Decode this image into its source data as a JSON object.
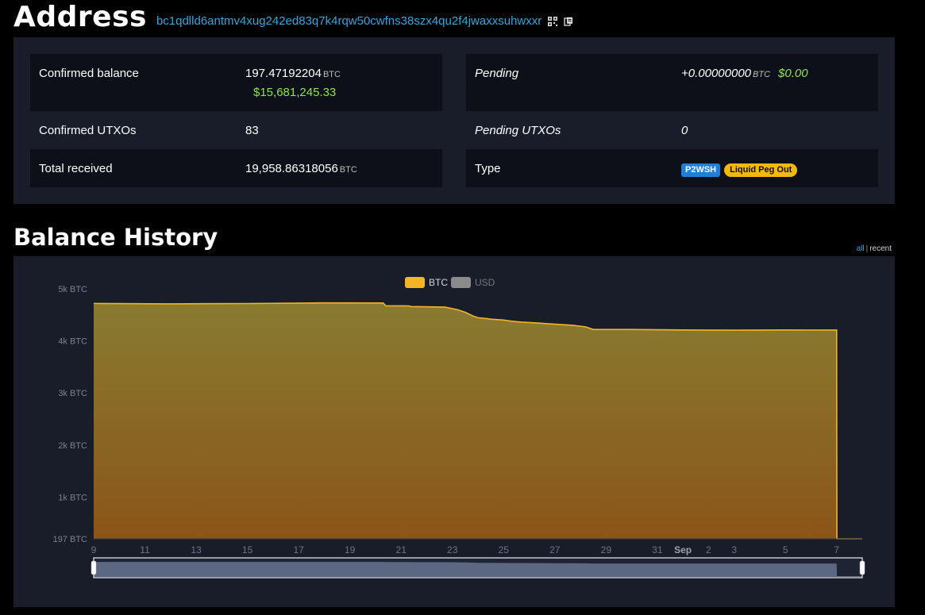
{
  "header": {
    "title": "Address",
    "address": "bc1qdlld6antmv4xug242ed83q7k4rqw50cwfns38szx4qu2f4jwaxxsuhwxxr",
    "qr_icon": "qr-code-icon",
    "copy_icon": "copy-icon"
  },
  "summary": {
    "confirmed_balance": {
      "label": "Confirmed balance",
      "value": "197.47192204",
      "unit": "BTC",
      "usd": "$15,681,245.33"
    },
    "confirmed_utxos": {
      "label": "Confirmed UTXOs",
      "value": "83"
    },
    "total_received": {
      "label": "Total received",
      "value": "19,958.86318056",
      "unit": "BTC"
    },
    "pending": {
      "label": "Pending",
      "value": "+0.00000000",
      "unit": "BTC",
      "usd": "$0.00"
    },
    "pending_utxos": {
      "label": "Pending UTXOs",
      "value": "0"
    },
    "type": {
      "label": "Type",
      "badges": [
        "P2WSH",
        "Liquid Peg Out"
      ]
    }
  },
  "balance_history": {
    "title": "Balance History",
    "range_links": [
      "all",
      "recent"
    ],
    "active_range": "all"
  },
  "colors": {
    "accent": "#2fa8df",
    "usd_green": "#8de34a",
    "btc_series": "#f5b426",
    "usd_series": "#8a8a8a",
    "panel": "#191d2a",
    "badge_blue": "#1e7fd8",
    "badge_yellow": "#f2b90a"
  },
  "chart_data": {
    "type": "area",
    "legend": [
      {
        "name": "BTC",
        "active": true
      },
      {
        "name": "USD",
        "active": false
      }
    ],
    "y_ticks": [
      "197 BTC",
      "1k BTC",
      "2k BTC",
      "3k BTC",
      "4k BTC",
      "5k BTC"
    ],
    "y_tick_values": [
      197,
      1000,
      2000,
      3000,
      4000,
      5000
    ],
    "ylim": [
      197,
      5000
    ],
    "x_ticks": [
      "9",
      "11",
      "13",
      "15",
      "17",
      "19",
      "21",
      "23",
      "25",
      "27",
      "29",
      "31",
      "Sep",
      "2",
      "3",
      "5",
      "7"
    ],
    "x_tick_days": [
      9,
      11,
      13,
      15,
      17,
      19,
      21,
      23,
      25,
      27,
      29,
      31,
      32,
      33,
      34,
      36,
      38
    ],
    "xlim": [
      9,
      39
    ],
    "series": [
      {
        "name": "BTC",
        "x": [
          9,
          12,
          15,
          18,
          20.3,
          20.4,
          21.3,
          21.4,
          22.7,
          23.2,
          23.5,
          23.8,
          24.0,
          24.3,
          24.5,
          25.0,
          25.3,
          25.7,
          26.3,
          26.7,
          27.1,
          27.7,
          28.2,
          28.5,
          30.0,
          32.0,
          34.0,
          36.0,
          38.0,
          38.01,
          39
        ],
        "y": [
          4720,
          4712,
          4718,
          4730,
          4728,
          4675,
          4672,
          4660,
          4650,
          4600,
          4550,
          4480,
          4445,
          4432,
          4418,
          4400,
          4380,
          4360,
          4345,
          4330,
          4318,
          4300,
          4270,
          4220,
          4220,
          4210,
          4206,
          4210,
          4208,
          197,
          197
        ]
      }
    ]
  }
}
